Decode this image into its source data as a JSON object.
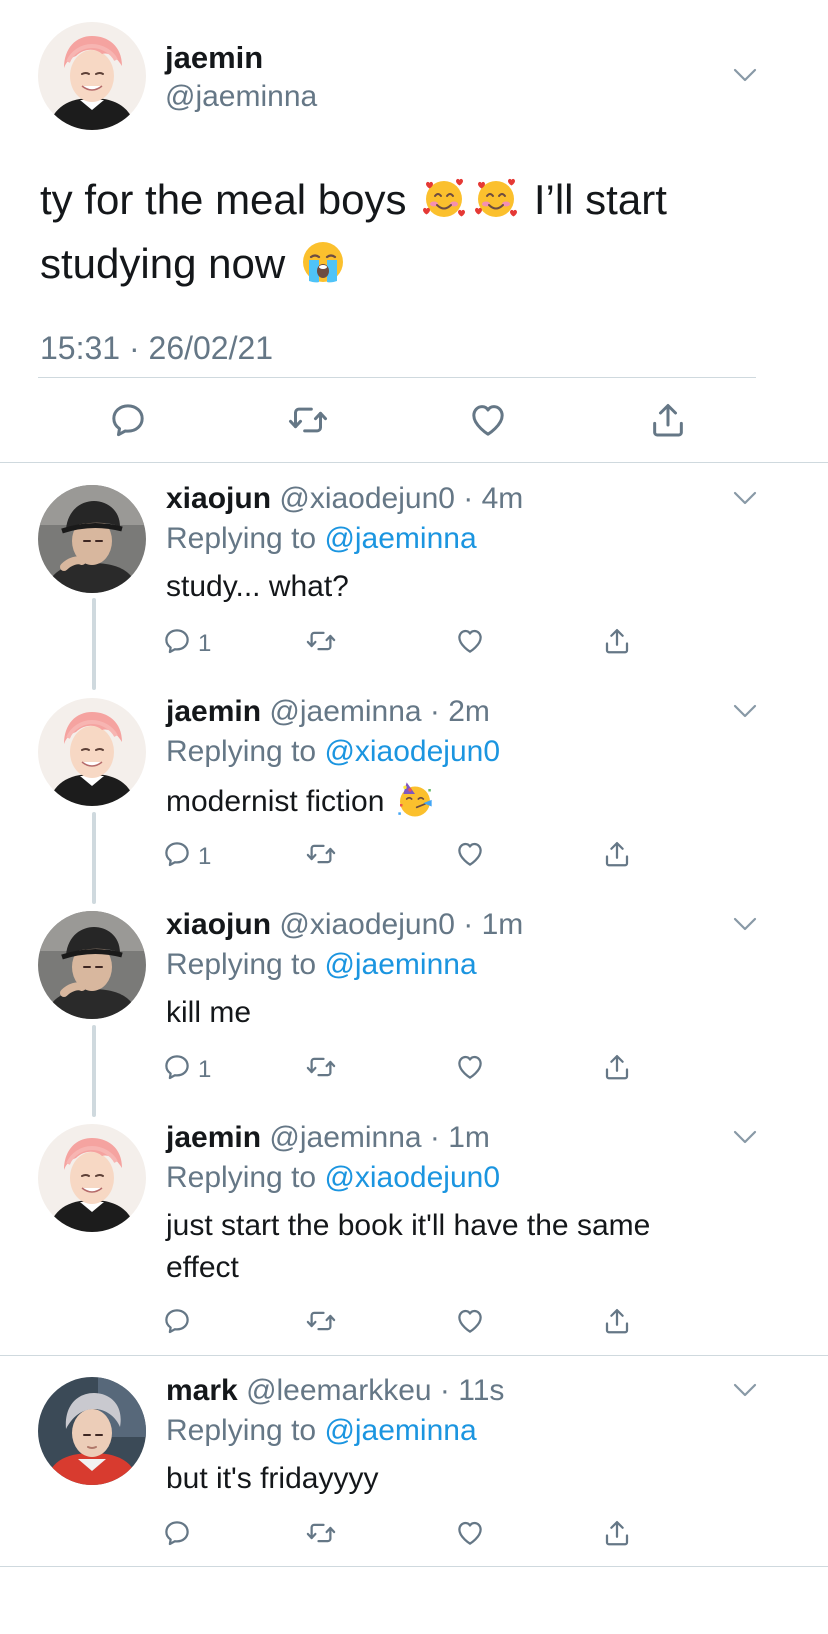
{
  "main_tweet": {
    "display_name": "jaemin",
    "handle": "@jaeminna",
    "text_part1": "ty for the meal boys",
    "text_part2": "I’ll start studying now",
    "emojis": [
      "smiling-face-with-hearts",
      "smiling-face-with-hearts",
      "loudly-crying-face"
    ],
    "timestamp": "15:31 · 26/02/21"
  },
  "replies": [
    {
      "display_name": "xiaojun",
      "handle_time": "@xiaodejun0 · 4m",
      "replying_prefix": "Replying to ",
      "replying_to": "@jaeminna",
      "text": "study... what?",
      "reply_count": "1"
    },
    {
      "display_name": "jaemin",
      "handle_time": "@jaeminna · 2m",
      "replying_prefix": "Replying to ",
      "replying_to": "@xiaodejun0",
      "text": "modernist fiction",
      "emoji": "partying-face",
      "reply_count": "1"
    },
    {
      "display_name": "xiaojun",
      "handle_time": "@xiaodejun0 · 1m",
      "replying_prefix": "Replying to ",
      "replying_to": "@jaeminna",
      "text": "kill me",
      "reply_count": "1"
    },
    {
      "display_name": "jaemin",
      "handle_time": "@jaeminna · 1m",
      "replying_prefix": "Replying to ",
      "replying_to": "@xiaodejun0",
      "text": "just start the book it'll have the same effect",
      "reply_count": ""
    },
    {
      "display_name": "mark",
      "handle_time": "@leemarkkeu · 11s",
      "replying_prefix": "Replying to ",
      "replying_to": "@jaeminna",
      "text": "but it's fridayyyy",
      "reply_count": ""
    }
  ],
  "colors": {
    "text": "#14171a",
    "secondary": "#657786",
    "link": "#1b95e0",
    "divider": "#cfd9de"
  },
  "icons": [
    "chevron-down-icon",
    "reply-icon",
    "retweet-icon",
    "like-icon",
    "share-icon"
  ]
}
